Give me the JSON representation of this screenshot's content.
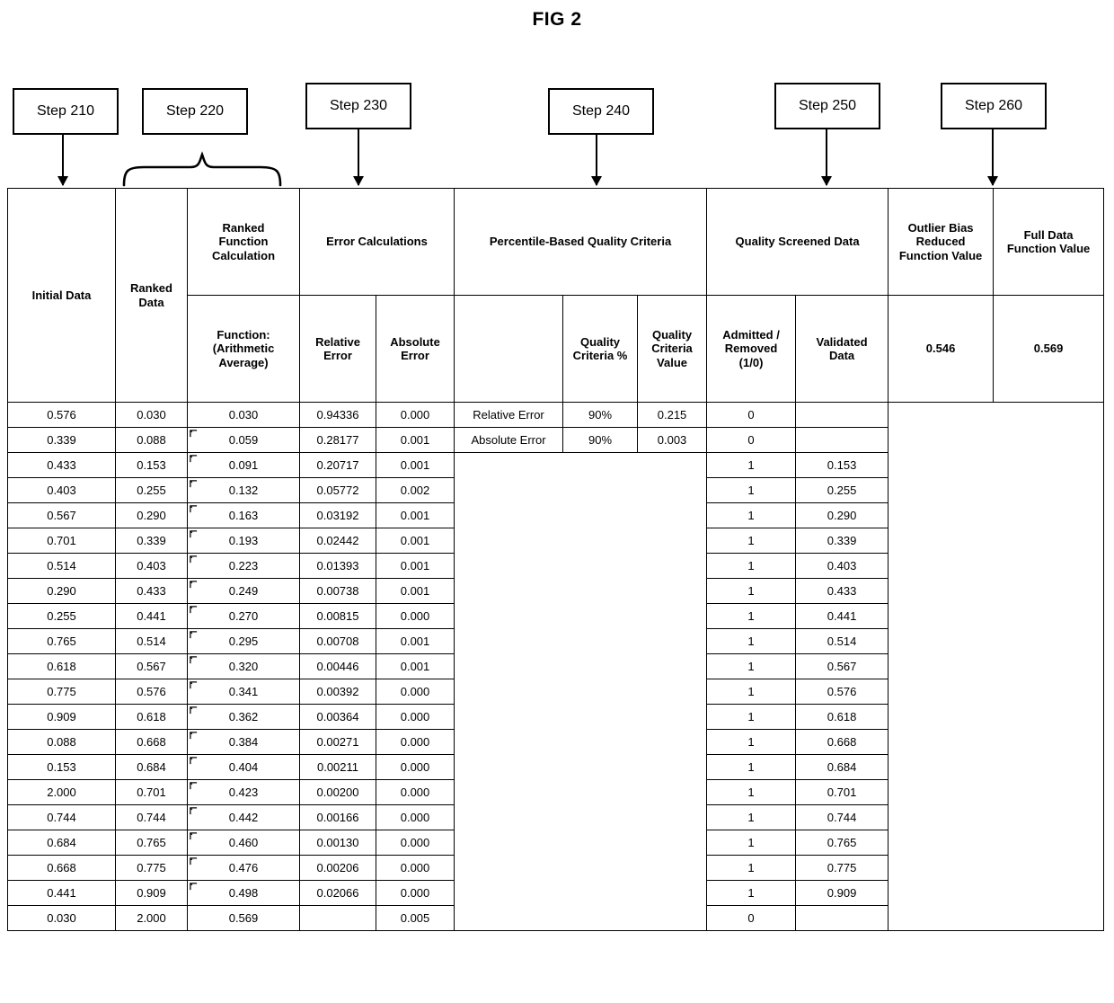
{
  "figure": {
    "title": "FIG 2"
  },
  "steps": [
    {
      "label": "Step 210",
      "marker": "arrow"
    },
    {
      "label": "Step 220",
      "marker": "brace"
    },
    {
      "label": "Step 230",
      "marker": "arrow"
    },
    {
      "label": "Step 240",
      "marker": "arrow"
    },
    {
      "label": "Step 250",
      "marker": "arrow"
    },
    {
      "label": "Step 260",
      "marker": "arrow"
    }
  ],
  "table": {
    "headers": {
      "initial_data": "Initial Data",
      "ranked_data": "Ranked Data",
      "ranked_function_calculation": "Ranked Function Calculation",
      "function_arithmetic_average": "Function: (Arithmetic Average)",
      "error_calculations": "Error Calculations",
      "relative_error": "Relative Error",
      "absolute_error": "Absolute Error",
      "percentile_based_quality_criteria": "Percentile-Based Quality Criteria",
      "criteria_blank": "",
      "quality_criteria_pct": "Quality Criteria %",
      "quality_criteria_value": "Quality Criteria Value",
      "quality_screened_data": "Quality Screened Data",
      "admitted_removed": "Admitted / Removed (1/0)",
      "validated_data": "Validated Data",
      "outlier_bias_reduced_function_value": "Outlier Bias Reduced Function Value",
      "full_data_function_value": "Full Data Function Value"
    },
    "summary": {
      "outlier_bias_reduced_function_value": "0.546",
      "full_data_function_value": "0.569"
    },
    "criteria_rows": [
      {
        "name": "Relative Error",
        "pct": "90%",
        "value": "0.215"
      },
      {
        "name": "Absolute Error",
        "pct": "90%",
        "value": "0.003"
      }
    ],
    "rows": [
      {
        "initial": "0.576",
        "ranked": "0.030",
        "func": "0.030",
        "rel": "0.94336",
        "abs": "0.000",
        "flag": "0",
        "validated": ""
      },
      {
        "initial": "0.339",
        "ranked": "0.088",
        "func": "0.059",
        "rel": "0.28177",
        "abs": "0.001",
        "flag": "0",
        "validated": ""
      },
      {
        "initial": "0.433",
        "ranked": "0.153",
        "func": "0.091",
        "rel": "0.20717",
        "abs": "0.001",
        "flag": "1",
        "validated": "0.153"
      },
      {
        "initial": "0.403",
        "ranked": "0.255",
        "func": "0.132",
        "rel": "0.05772",
        "abs": "0.002",
        "flag": "1",
        "validated": "0.255"
      },
      {
        "initial": "0.567",
        "ranked": "0.290",
        "func": "0.163",
        "rel": "0.03192",
        "abs": "0.001",
        "flag": "1",
        "validated": "0.290"
      },
      {
        "initial": "0.701",
        "ranked": "0.339",
        "func": "0.193",
        "rel": "0.02442",
        "abs": "0.001",
        "flag": "1",
        "validated": "0.339"
      },
      {
        "initial": "0.514",
        "ranked": "0.403",
        "func": "0.223",
        "rel": "0.01393",
        "abs": "0.001",
        "flag": "1",
        "validated": "0.403"
      },
      {
        "initial": "0.290",
        "ranked": "0.433",
        "func": "0.249",
        "rel": "0.00738",
        "abs": "0.001",
        "flag": "1",
        "validated": "0.433"
      },
      {
        "initial": "0.255",
        "ranked": "0.441",
        "func": "0.270",
        "rel": "0.00815",
        "abs": "0.000",
        "flag": "1",
        "validated": "0.441"
      },
      {
        "initial": "0.765",
        "ranked": "0.514",
        "func": "0.295",
        "rel": "0.00708",
        "abs": "0.001",
        "flag": "1",
        "validated": "0.514"
      },
      {
        "initial": "0.618",
        "ranked": "0.567",
        "func": "0.320",
        "rel": "0.00446",
        "abs": "0.001",
        "flag": "1",
        "validated": "0.567"
      },
      {
        "initial": "0.775",
        "ranked": "0.576",
        "func": "0.341",
        "rel": "0.00392",
        "abs": "0.000",
        "flag": "1",
        "validated": "0.576"
      },
      {
        "initial": "0.909",
        "ranked": "0.618",
        "func": "0.362",
        "rel": "0.00364",
        "abs": "0.000",
        "flag": "1",
        "validated": "0.618"
      },
      {
        "initial": "0.088",
        "ranked": "0.668",
        "func": "0.384",
        "rel": "0.00271",
        "abs": "0.000",
        "flag": "1",
        "validated": "0.668"
      },
      {
        "initial": "0.153",
        "ranked": "0.684",
        "func": "0.404",
        "rel": "0.00211",
        "abs": "0.000",
        "flag": "1",
        "validated": "0.684"
      },
      {
        "initial": "2.000",
        "ranked": "0.701",
        "func": "0.423",
        "rel": "0.00200",
        "abs": "0.000",
        "flag": "1",
        "validated": "0.701"
      },
      {
        "initial": "0.744",
        "ranked": "0.744",
        "func": "0.442",
        "rel": "0.00166",
        "abs": "0.000",
        "flag": "1",
        "validated": "0.744"
      },
      {
        "initial": "0.684",
        "ranked": "0.765",
        "func": "0.460",
        "rel": "0.00130",
        "abs": "0.000",
        "flag": "1",
        "validated": "0.765"
      },
      {
        "initial": "0.668",
        "ranked": "0.775",
        "func": "0.476",
        "rel": "0.00206",
        "abs": "0.000",
        "flag": "1",
        "validated": "0.775"
      },
      {
        "initial": "0.441",
        "ranked": "0.909",
        "func": "0.498",
        "rel": "0.02066",
        "abs": "0.000",
        "flag": "1",
        "validated": "0.909"
      },
      {
        "initial": "0.030",
        "ranked": "2.000",
        "func": "0.569",
        "rel": "",
        "abs": "0.005",
        "flag": "0",
        "validated": ""
      }
    ]
  }
}
